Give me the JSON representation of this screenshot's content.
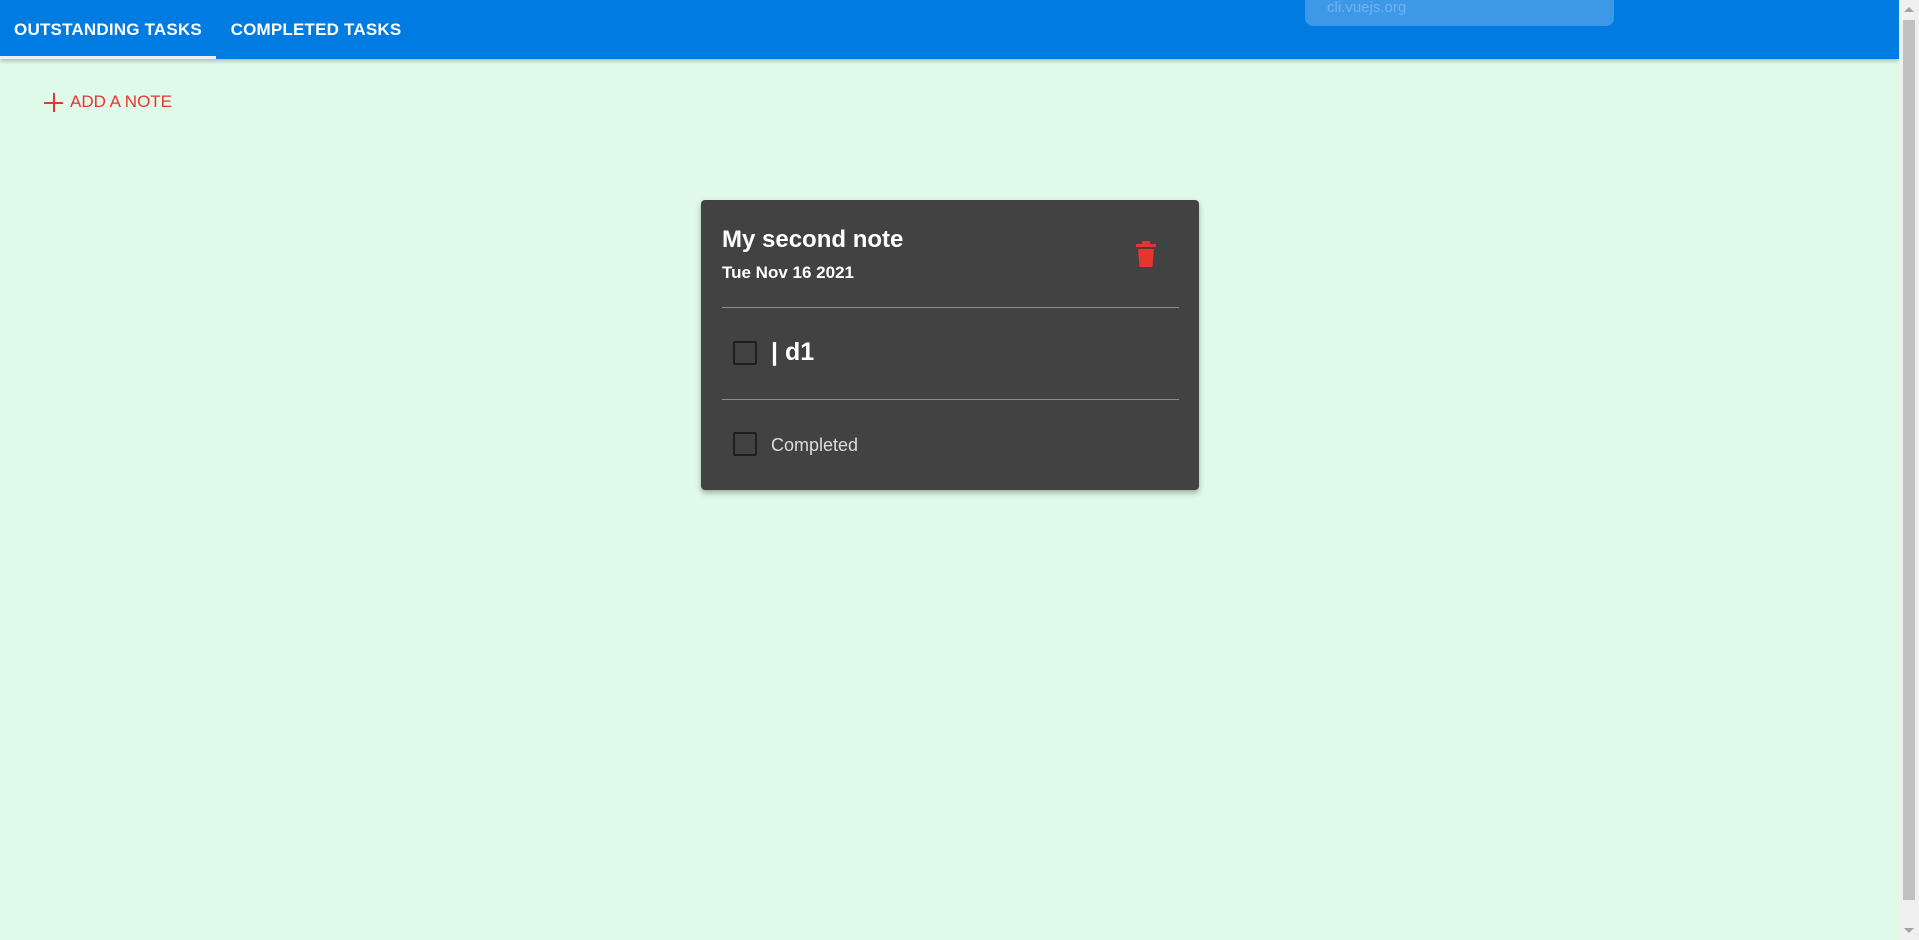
{
  "tabs": [
    {
      "label": "OUTSTANDING TASKS",
      "active": true
    },
    {
      "label": "COMPLETED TASKS",
      "active": false
    }
  ],
  "hint_text": "cli.vuejs.org",
  "add_note_label": "ADD A NOTE",
  "note": {
    "title": "My second note",
    "date": "Tue Nov 16 2021",
    "task_text": "| d1",
    "task_checked": false,
    "completed_label": "Completed",
    "completed_checked": false
  },
  "icons": {
    "add": "plus-icon",
    "delete": "trash-icon"
  },
  "colors": {
    "app_bar": "#007be2",
    "background": "#e0faea",
    "card": "#424242",
    "accent": "#e53530"
  }
}
